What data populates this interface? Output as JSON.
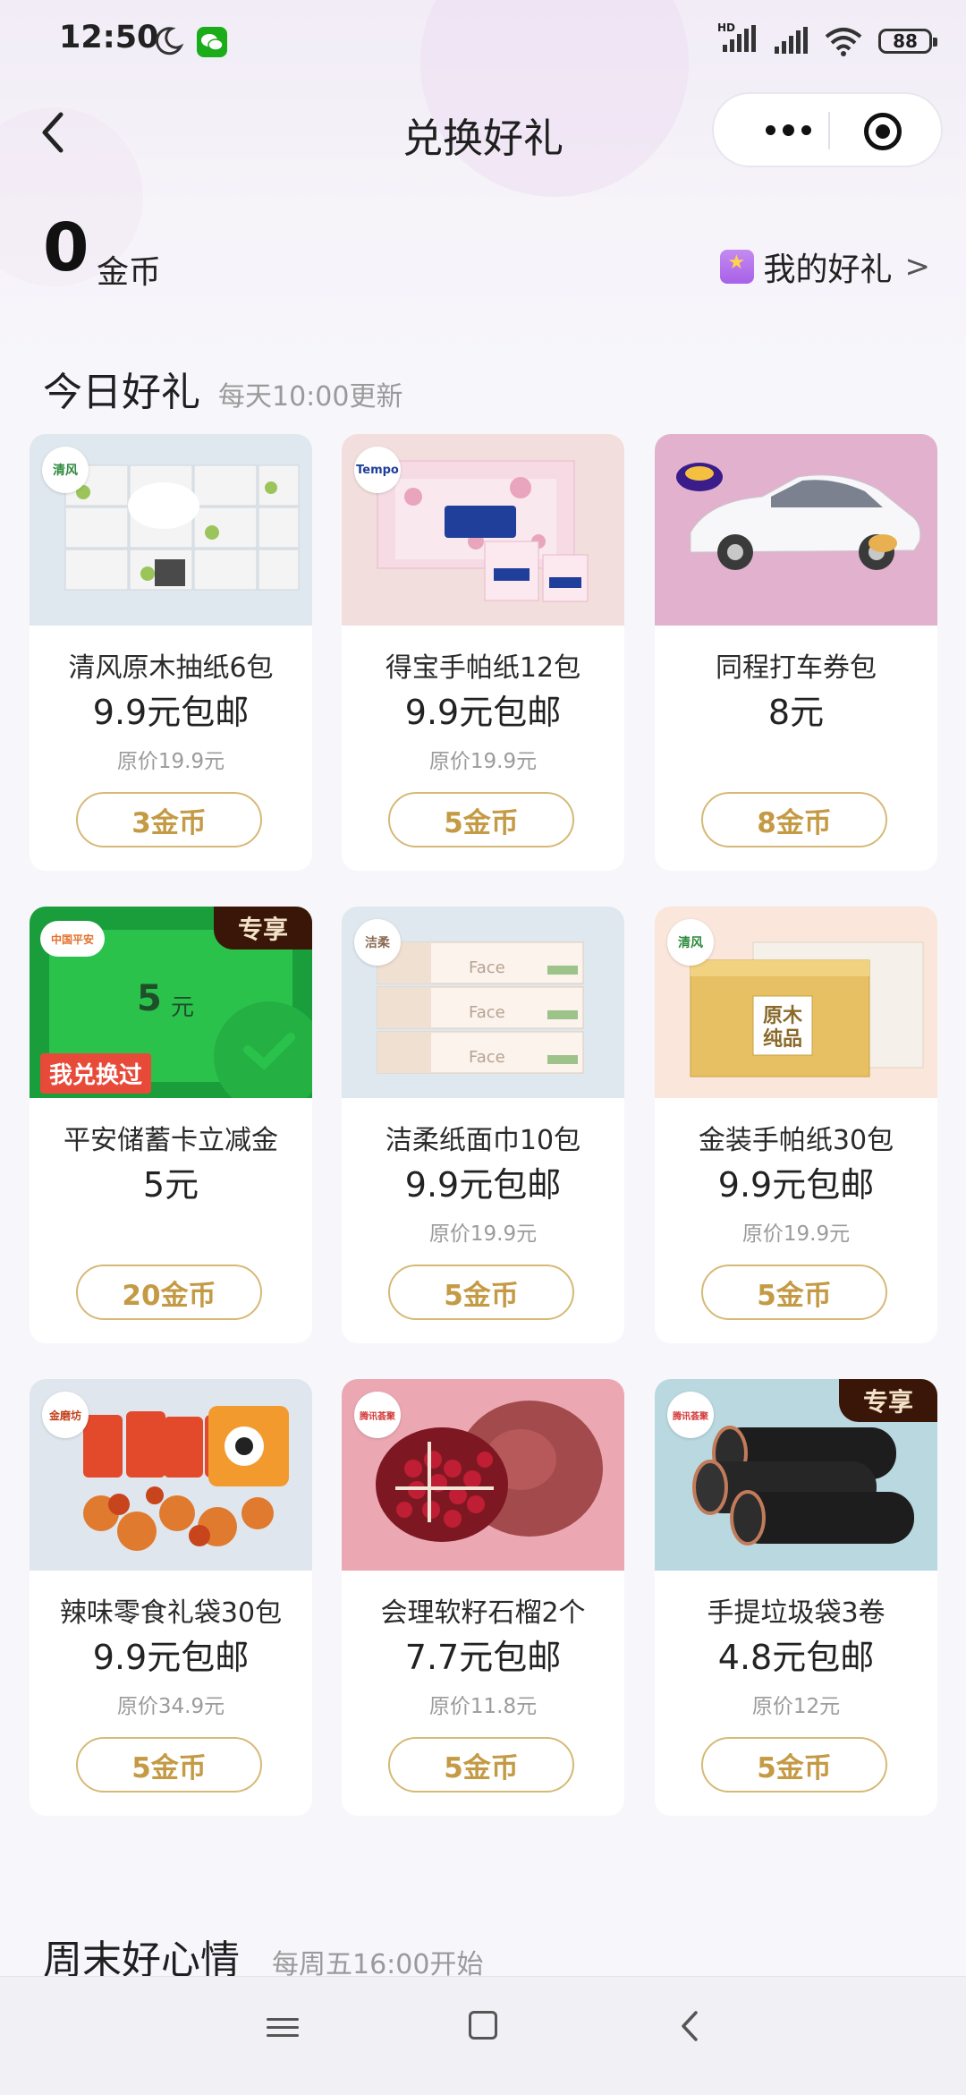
{
  "status_bar": {
    "time": "12:50",
    "network_label": "HD",
    "battery": "88",
    "icons": [
      "moon-icon",
      "wechat-icon",
      "signal-icon",
      "wifi-icon",
      "battery-icon"
    ]
  },
  "header": {
    "title": "兑换好礼",
    "back_icon": "chevron-left-icon",
    "more_icon": "more-dots-icon",
    "close_icon": "target-close-icon"
  },
  "coins": {
    "value": "0",
    "unit": "金币",
    "my_gifts_label": "我的好礼",
    "my_gifts_chevron": ">"
  },
  "section_today": {
    "title": "今日好礼",
    "subtitle": "每天10:00更新"
  },
  "products": [
    {
      "name": "清风原木抽纸6包",
      "price": "9.9元包邮",
      "original": "原价19.9元",
      "cost": "3金币",
      "logo": "清风",
      "exclusive": ""
    },
    {
      "name": "得宝手帕纸12包",
      "price": "9.9元包邮",
      "original": "原价19.9元",
      "cost": "5金币",
      "logo": "Tempo",
      "exclusive": ""
    },
    {
      "name": "同程打车券包",
      "price": "8元",
      "original": "",
      "cost": "8金币",
      "logo": "",
      "exclusive": ""
    },
    {
      "name": "平安储蓄卡立减金",
      "price": "5元",
      "original": "",
      "cost": "20金币",
      "logo": "中国平安",
      "exclusive": "专享",
      "image_amount": "5",
      "image_unit": "元",
      "image_tag": "我兑换过"
    },
    {
      "name": "洁柔纸面巾10包",
      "price": "9.9元包邮",
      "original": "原价19.9元",
      "cost": "5金币",
      "logo": "洁柔",
      "exclusive": "",
      "image_text": "Face"
    },
    {
      "name": "金装手帕纸30包",
      "price": "9.9元包邮",
      "original": "原价19.9元",
      "cost": "5金币",
      "logo": "清风",
      "exclusive": "",
      "image_text": "原木纯品"
    },
    {
      "name": "辣味零食礼袋30包",
      "price": "9.9元包邮",
      "original": "原价34.9元",
      "cost": "5金币",
      "logo": "金磨坊",
      "exclusive": ""
    },
    {
      "name": "会理软籽石榴2个",
      "price": "7.7元包邮",
      "original": "原价11.8元",
      "cost": "5金币",
      "logo": "腾讯荟聚",
      "exclusive": ""
    },
    {
      "name": "手提垃圾袋3卷",
      "price": "4.8元包邮",
      "original": "原价12元",
      "cost": "5金币",
      "logo": "腾讯荟聚",
      "exclusive": "专享"
    }
  ],
  "section_weekend": {
    "title": "周末好心情",
    "subtitle": "每周五16:00开始"
  },
  "navbar": {
    "icons": [
      "menu-icon",
      "home-icon",
      "back-icon"
    ]
  }
}
